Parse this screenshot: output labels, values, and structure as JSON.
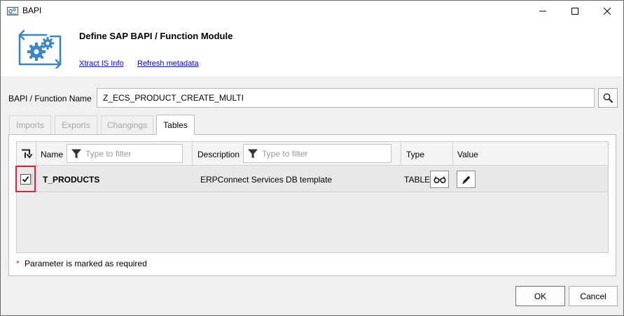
{
  "window": {
    "title": "BAPI"
  },
  "header": {
    "heading": "Define SAP BAPI / Function Module",
    "links": {
      "info": "Xtract IS Info",
      "refresh": "Refresh metadata"
    }
  },
  "function": {
    "label": "BAPI / Function Name",
    "value": "Z_ECS_PRODUCT_CREATE_MULTI"
  },
  "tabs": [
    {
      "label": "Imports",
      "active": false
    },
    {
      "label": "Exports",
      "active": false
    },
    {
      "label": "Changings",
      "active": false
    },
    {
      "label": "Tables",
      "active": true
    }
  ],
  "grid": {
    "columns": {
      "name": "Name",
      "description": "Description",
      "type": "Type",
      "value": "Value"
    },
    "filter_placeholder": "Type to filter",
    "rows": [
      {
        "checked": true,
        "name": "T_PRODUCTS",
        "description": "ERPConnect Services DB template",
        "type": "TABLE"
      }
    ]
  },
  "required_note": {
    "marker": "*",
    "text": "Parameter is marked as required"
  },
  "buttons": {
    "ok": "OK",
    "cancel": "Cancel"
  },
  "icons": {
    "app": "bapi-window-icon",
    "logo": "gears-exchange-icon",
    "search": "search-icon",
    "filter": "filter-icon",
    "glasses": "view-glasses-icon",
    "edit": "pencil-edit-icon",
    "selection_header": "selection-arrow-icon"
  },
  "colors": {
    "link": "#0000ee",
    "highlight": "#d6253c",
    "logo": "#3c86c6",
    "required": "#d6253c"
  }
}
